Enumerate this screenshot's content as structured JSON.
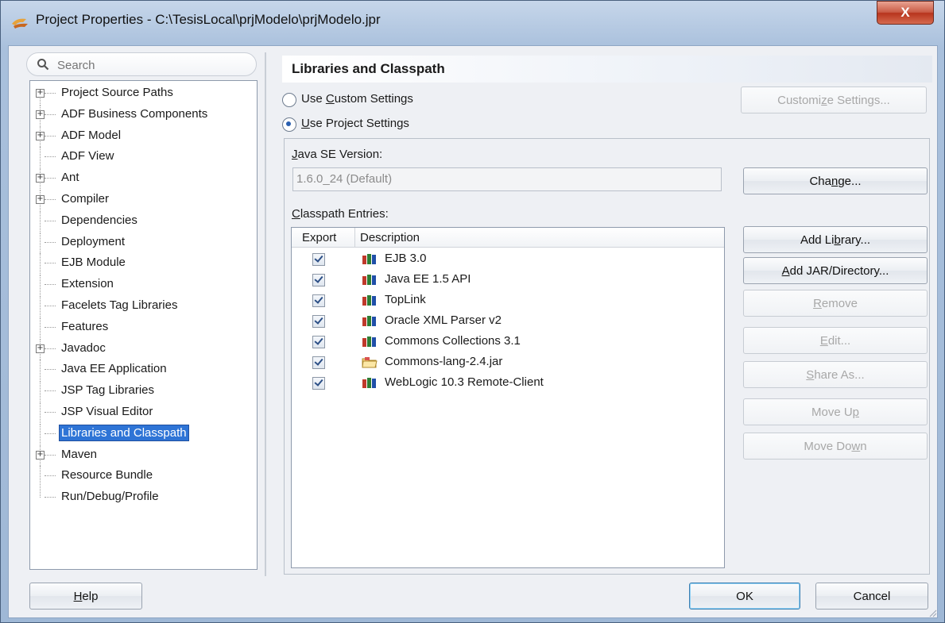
{
  "window": {
    "title": "Project Properties - C:\\TesisLocal\\prjModelo\\prjModelo.jpr",
    "close_glyph": "X"
  },
  "search": {
    "placeholder": "Search"
  },
  "tree": [
    {
      "label": "Project Source Paths",
      "expandable": true
    },
    {
      "label": "ADF Business Components",
      "expandable": true
    },
    {
      "label": "ADF Model",
      "expandable": true
    },
    {
      "label": "ADF View",
      "expandable": false
    },
    {
      "label": "Ant",
      "expandable": true
    },
    {
      "label": "Compiler",
      "expandable": true
    },
    {
      "label": "Dependencies",
      "expandable": false
    },
    {
      "label": "Deployment",
      "expandable": false
    },
    {
      "label": "EJB Module",
      "expandable": false
    },
    {
      "label": "Extension",
      "expandable": false
    },
    {
      "label": "Facelets Tag Libraries",
      "expandable": false
    },
    {
      "label": "Features",
      "expandable": false
    },
    {
      "label": "Javadoc",
      "expandable": true
    },
    {
      "label": "Java EE Application",
      "expandable": false
    },
    {
      "label": "JSP Tag Libraries",
      "expandable": false
    },
    {
      "label": "JSP Visual Editor",
      "expandable": false
    },
    {
      "label": "Libraries and Classpath",
      "expandable": false,
      "selected": true
    },
    {
      "label": "Maven",
      "expandable": true
    },
    {
      "label": "Resource Bundle",
      "expandable": false
    },
    {
      "label": "Run/Debug/Profile",
      "expandable": false
    }
  ],
  "panel": {
    "title": "Libraries and Classpath",
    "radio_custom": {
      "pre": "Use ",
      "mnemonic": "C",
      "post": "ustom Settings",
      "selected": false
    },
    "radio_project": {
      "pre": "",
      "mnemonic": "U",
      "post": "se Project Settings",
      "selected": true
    },
    "customize_button": {
      "pre": "Customi",
      "mnemonic": "z",
      "post": "e Settings..."
    },
    "java_se": {
      "label_mnemonic": "J",
      "label_rest": "ava SE Version:",
      "value": "1.6.0_24 (Default)"
    },
    "change_button": {
      "pre": "Cha",
      "mnemonic": "n",
      "post": "ge..."
    },
    "classpath": {
      "label_mnemonic": "C",
      "label_rest": "lasspath Entries:",
      "col_export": "Export",
      "col_description": "Description",
      "rows": [
        {
          "description": "EJB 3.0",
          "export": true,
          "icon": "library-icon"
        },
        {
          "description": "Java EE 1.5 API",
          "export": true,
          "icon": "library-icon"
        },
        {
          "description": "TopLink",
          "export": true,
          "icon": "library-icon"
        },
        {
          "description": "Oracle XML Parser v2",
          "export": true,
          "icon": "library-icon"
        },
        {
          "description": "Commons Collections 3.1",
          "export": true,
          "icon": "library-icon"
        },
        {
          "description": "Commons-lang-2.4.jar",
          "export": true,
          "icon": "jar-folder-icon"
        },
        {
          "description": "WebLogic 10.3 Remote-Client",
          "export": true,
          "icon": "library-icon"
        }
      ]
    },
    "buttons": {
      "add_library": {
        "pre": "Add Li",
        "mnemonic": "b",
        "post": "rary..."
      },
      "add_jar": {
        "pre": "",
        "mnemonic": "A",
        "post": "dd JAR/Directory..."
      },
      "remove": {
        "pre": "",
        "mnemonic": "R",
        "post": "emove"
      },
      "edit": {
        "pre": "",
        "mnemonic": "E",
        "post": "dit..."
      },
      "share_as": {
        "pre": "",
        "mnemonic": "S",
        "post": "hare As..."
      },
      "move_up": {
        "pre": "Move U",
        "mnemonic": "p",
        "post": ""
      },
      "move_down": {
        "pre": "Move Do",
        "mnemonic": "w",
        "post": "n"
      }
    }
  },
  "footer": {
    "help": {
      "pre": "",
      "mnemonic": "H",
      "post": "elp"
    },
    "ok": "OK",
    "cancel": "Cancel"
  },
  "colors": {
    "selection": "#2e74d6",
    "close_button": "#c95b45",
    "window_frame": "#a9c0dc"
  }
}
